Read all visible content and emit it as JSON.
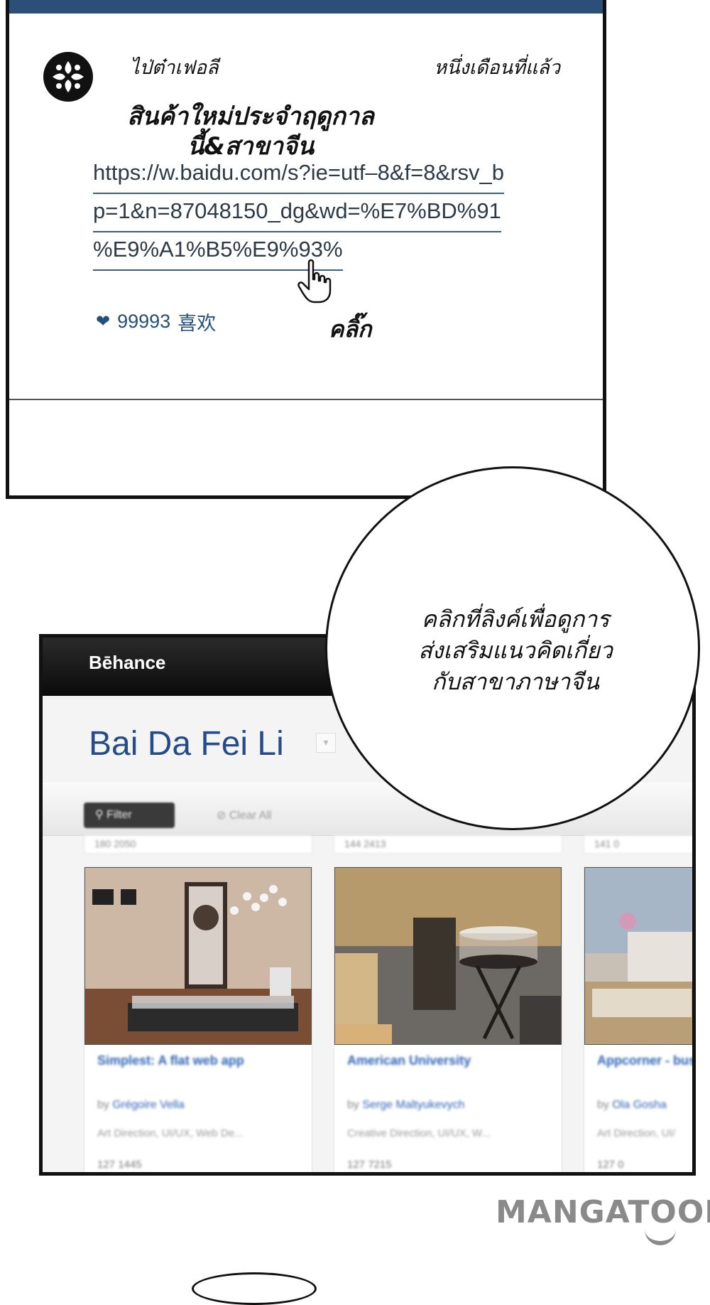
{
  "post": {
    "username": "ไป่ต๋าเฟอลี",
    "time": "หนึ่งเดือนที่แล้ว",
    "title_line1": "สินค้าใหม่ประจำฤดูกาล",
    "title_line2": "นี้&สาขาจีน",
    "link_lines": [
      "https://w.baidu.com/s?ie=utf–8&f=8&rsv_b",
      "p=1&n=87048150_dg&wd=%E7%BD%91",
      "%E9%A1%B5%E9%93%"
    ],
    "likes_count": "99993",
    "likes_label": "喜欢",
    "click_label": "คลิ๊ก"
  },
  "behance": {
    "logo": "Bēhance",
    "page_title": "Bai Da Fei Li",
    "filter_label": "Filter",
    "clear_all_label": "Clear All",
    "cards": [
      {
        "title": "Simplest: A flat web app",
        "by": "by",
        "author": "Grégoire Vella",
        "fields": "Art Direction, UI/UX, Web De...",
        "stats": "127   1445"
      },
      {
        "title": "American University",
        "by": "by",
        "author": "Serge Maltyukevych",
        "fields": "Creative Direction, UI/UX, W...",
        "stats": "127   7215"
      },
      {
        "title": "Appcorner - business&tech",
        "by": "by",
        "author": "Ola Gosha",
        "fields": "Art Direction, UI/",
        "stats": "127   0"
      }
    ],
    "prev_row_stats": [
      "180   2050",
      "144   2413",
      "141   0"
    ]
  },
  "bubble": {
    "line1": "คลิกที่ลิงค์เพื่อดูการ",
    "line2": "ส่งเสริมแนวคิดเกี่ยว",
    "line3": "กับสาขาภาษาจีน"
  },
  "watermark": "MANGATOON",
  "colors": {
    "post_topbar": "#2b4f79",
    "link_text": "#2d3a48",
    "likes": "#244f7c",
    "behance_title": "#254c88",
    "card_link": "#2d63b5"
  }
}
